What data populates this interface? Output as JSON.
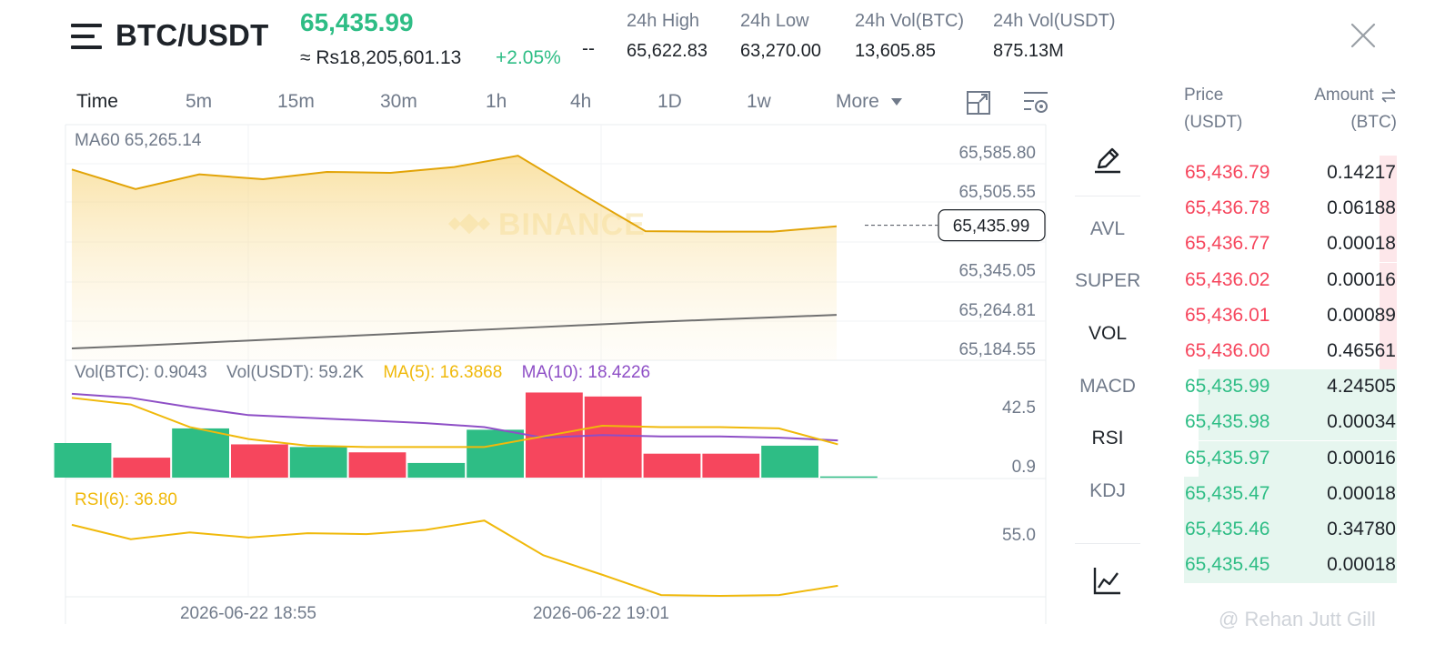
{
  "header": {
    "pair": "BTC/USDT",
    "last_price": "65,435.99",
    "fiat_price": "≈ Rs18,205,601.13",
    "change_pct": "+2.05%",
    "extra": "--",
    "stats": [
      {
        "label": "24h High",
        "value": "65,622.83"
      },
      {
        "label": "24h Low",
        "value": "63,270.00"
      },
      {
        "label": "24h Vol(BTC)",
        "value": "13,605.85"
      },
      {
        "label": "24h Vol(USDT)",
        "value": "875.13M"
      }
    ]
  },
  "tabs": [
    "Time",
    "5m",
    "15m",
    "30m",
    "1h",
    "4h",
    "1D",
    "1w",
    "More"
  ],
  "active_tab": "Time",
  "icons": {
    "menu": "menu-icon",
    "close": "close-icon",
    "fullscreen": "expand-chart-icon",
    "settings": "chart-settings-icon",
    "draw": "pencil-icon",
    "indicator": "line-chart-icon",
    "more_caret": "caret-down-icon",
    "swap": "swap-arrows-icon"
  },
  "colors": {
    "up": "#2ebd85",
    "down": "#f6465d",
    "ma5": "#f0b90b",
    "ma10": "#8e4fc6",
    "price_line": "#e2a408",
    "ma60": "#707070"
  },
  "chart_data": {
    "type": "line",
    "x_labels": [
      "2026-06-22 18:55",
      "2026-06-22 19:01"
    ],
    "watermark": "BINANCE",
    "price_panel": {
      "legend": "MA60 65,265.14",
      "ticks": [
        "65,585.80",
        "65,505.55",
        "65,345.05",
        "65,264.81",
        "65,184.55"
      ],
      "ylim": [
        65184.55,
        65585.8
      ],
      "current_price": "65,435.99",
      "current_value": 65435.99,
      "series": [
        {
          "name": "Price",
          "values": [
            65550,
            65510,
            65540,
            65530,
            65545,
            65543,
            65555,
            65578,
            65500,
            65424,
            65423,
            65423,
            65434
          ]
        },
        {
          "name": "MA60",
          "values": [
            65184.6,
            65190,
            65196,
            65202,
            65208,
            65214,
            65220,
            65226,
            65232,
            65238,
            65243,
            65248,
            65253
          ]
        }
      ]
    },
    "volume_panel": {
      "legend": {
        "vol_btc": "Vol(BTC): 0.9043",
        "vol_usdt": "Vol(USDT): 59.2K",
        "ma5": "MA(5): 16.3868",
        "ma10": "MA(10): 18.4226"
      },
      "ticks": [
        "42.5",
        "0.9"
      ],
      "ylim": [
        0,
        65
      ],
      "bars": [
        {
          "value": 26,
          "dir": "up"
        },
        {
          "value": 15,
          "dir": "down"
        },
        {
          "value": 37,
          "dir": "up"
        },
        {
          "value": 25,
          "dir": "down"
        },
        {
          "value": 23,
          "dir": "up"
        },
        {
          "value": 19,
          "dir": "down"
        },
        {
          "value": 11,
          "dir": "up"
        },
        {
          "value": 36,
          "dir": "up"
        },
        {
          "value": 64,
          "dir": "down"
        },
        {
          "value": 61,
          "dir": "down"
        },
        {
          "value": 18,
          "dir": "down"
        },
        {
          "value": 18,
          "dir": "down"
        },
        {
          "value": 24,
          "dir": "up"
        },
        {
          "value": 0.9,
          "dir": "up"
        }
      ],
      "ma5": [
        60,
        55,
        38,
        29,
        24,
        23,
        23,
        23,
        31,
        39,
        38,
        38,
        37,
        25
      ],
      "ma10": [
        63,
        60,
        53,
        47,
        45,
        43,
        41,
        38,
        30,
        32,
        31,
        31,
        30,
        28
      ]
    },
    "rsi_panel": {
      "legend": "RSI(6): 36.80",
      "ticks": [
        "55.0"
      ],
      "ylim": [
        0,
        100
      ],
      "values": [
        84,
        67,
        75,
        69,
        74,
        73,
        78,
        89,
        48,
        25,
        1,
        0,
        1,
        12
      ]
    }
  },
  "indicators": {
    "avl": "AVL",
    "super": "SUPER",
    "vol": "VOL",
    "macd": "MACD",
    "rsi": "RSI",
    "kdj": "KDJ"
  },
  "orderbook": {
    "price_head": "Price",
    "price_unit": "(USDT)",
    "amount_head": "Amount",
    "amount_unit": "(BTC)",
    "asks": [
      {
        "price": "65,436.79",
        "amount": "0.14217",
        "depth": 0.08
      },
      {
        "price": "65,436.78",
        "amount": "0.06188",
        "depth": 0.08
      },
      {
        "price": "65,436.77",
        "amount": "0.00018",
        "depth": 0.08
      },
      {
        "price": "65,436.02",
        "amount": "0.00016",
        "depth": 0.08
      },
      {
        "price": "65,436.01",
        "amount": "0.00089",
        "depth": 0.08
      },
      {
        "price": "65,436.00",
        "amount": "0.46561",
        "depth": 0.08
      }
    ],
    "bids": [
      {
        "price": "65,435.99",
        "amount": "4.24505",
        "depth": 0.93
      },
      {
        "price": "65,435.98",
        "amount": "0.00034",
        "depth": 0.93
      },
      {
        "price": "65,435.97",
        "amount": "0.00016",
        "depth": 0.93
      },
      {
        "price": "65,435.47",
        "amount": "0.00018",
        "depth": 1.0
      },
      {
        "price": "65,435.46",
        "amount": "0.34780",
        "depth": 1.0
      },
      {
        "price": "65,435.45",
        "amount": "0.00018",
        "depth": 1.0
      }
    ]
  },
  "watermark": "@ Rehan Jutt Gill"
}
